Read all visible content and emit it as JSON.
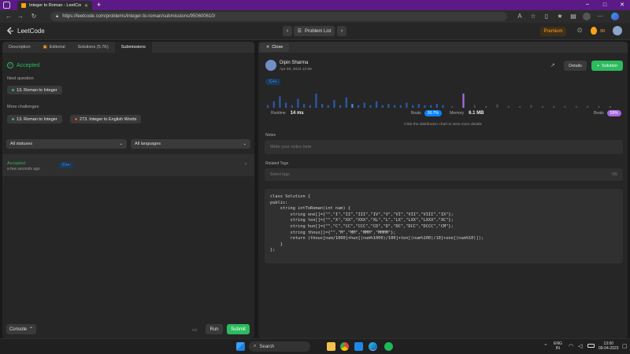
{
  "browser": {
    "tab_title": "Integer to Roman - LeetCode",
    "url": "https://leetcode.com/problems/integer-to-roman/submissions/950600610/"
  },
  "nav": {
    "logo": "LeetCode",
    "problem_list": "Problem List",
    "premium": "Premium",
    "streak": "99"
  },
  "left": {
    "tabs": [
      "Description",
      "Editorial",
      "Solutions (5.7K)",
      "Submissions"
    ],
    "accepted": "Accepted",
    "next_question_label": "Next question",
    "next_question": "13. Roman to Integer",
    "more_challenges_label": "More challenges",
    "challenges": [
      "13. Roman to Integer",
      "273. Integer to English Words"
    ],
    "status_select": "All statuses",
    "language_select": "All languages",
    "submission": {
      "status": "Accepted",
      "time": "a few seconds ago",
      "lang": "C++"
    },
    "console": "Console",
    "run": "Run",
    "submit": "Submit"
  },
  "right": {
    "close": "Close",
    "user": "Dipin Sharma",
    "date": "Apr 09, 2023 12:59",
    "details": "Details",
    "solution": "Solution",
    "lang": "C++",
    "runtime_label": "Runtime",
    "runtime_value": "14 ms",
    "beats_label": "Beats",
    "runtime_beats": "30.7%",
    "memory_label": "Memory",
    "memory_value": "6.1 MB",
    "memory_beats": "55%",
    "distribution_hint": "Click the distribution chart to view more details",
    "notes_label": "Notes",
    "notes_placeholder": "Write your notes here",
    "tags_label": "Related Tags",
    "tags_placeholder": "Select tags",
    "tags_count": "0/5",
    "code_lines": [
      "class Solution {",
      "public:",
      "    string intToRoman(int num) {",
      "        string one[]={\"\",\"I\",\"II\",\"III\",\"IV\",\"V\",\"VI\",\"VII\",\"VIII\",\"IX\"};",
      "        string ten[]={\"\",\"X\",\"XX\",\"XXX\",\"XL\",\"L\",\"LX\",\"LXX\",\"LXXX\",\"XC\"};",
      "        string hun[]={\"\",\"C\",\"CC\",\"CCC\",\"CD\",\"D\",\"DC\",\"DCC\",\"DCCC\",\"CM\"};",
      "        string thous[]={\"\",\"M\",\"MM\",\"MMM\",\"MMMM\"};",
      "        return (thous[num/1000]+hun[(num%1000)/100]+ten[(num%100)/10]+one[(num%10)]);",
      "    }",
      "};"
    ]
  },
  "runtime_bars": [
    2,
    5,
    9,
    4,
    2,
    7,
    3,
    2,
    11,
    3,
    2,
    6,
    2,
    8,
    3,
    2,
    4,
    2,
    5,
    2,
    3,
    2,
    2,
    4,
    2,
    3,
    2,
    2,
    3,
    2
  ],
  "runtime_highlight_index": 14,
  "memory_bars": [
    2,
    16,
    3,
    2,
    4,
    2,
    2,
    3,
    2,
    2,
    2,
    2,
    2,
    2,
    2
  ],
  "memory_highlight_index": 1,
  "taskbar": {
    "search": "Search",
    "lang_top": "ENG",
    "lang_bottom": "IN",
    "time": "13:00",
    "date": "09-04-2023"
  },
  "colors": {
    "accent_green": "#2cbb5d",
    "accent_blue": "#0a84ff",
    "purple": "#a66bde",
    "orange": "#ffa116"
  }
}
